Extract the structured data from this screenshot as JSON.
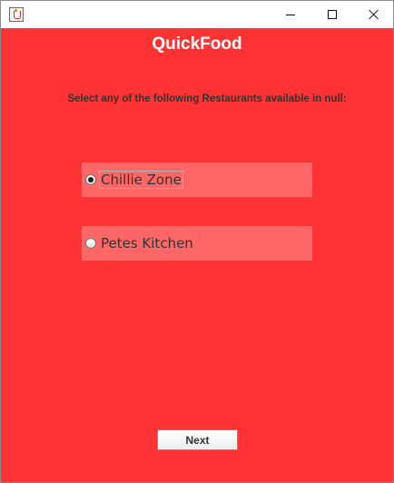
{
  "window": {
    "title": ""
  },
  "header": {
    "app_title": "QuickFood"
  },
  "prompt": {
    "text": "Select any of the following Restaurants available in null:"
  },
  "restaurants": [
    {
      "label": "Chillie Zone",
      "selected": true
    },
    {
      "label": "Petes Kitchen",
      "selected": false
    }
  ],
  "actions": {
    "next_label": "Next"
  },
  "colors": {
    "background": "#ff3333",
    "option_background": "#ff6666",
    "title_text": "#ffffff"
  }
}
